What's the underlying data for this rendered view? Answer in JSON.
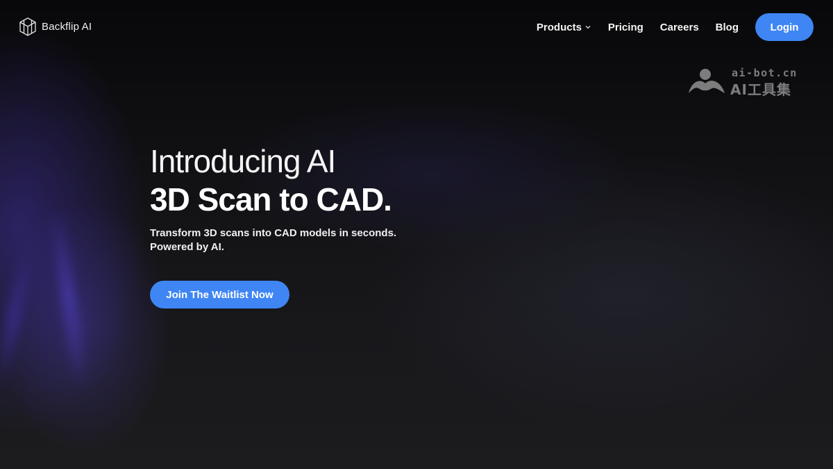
{
  "brand": {
    "name": "Backflip AI",
    "logo_icon": "cube-logo-icon"
  },
  "nav": {
    "items": [
      {
        "label": "Products",
        "icon": "chevron-down-icon"
      },
      {
        "label": "Pricing"
      },
      {
        "label": "Careers"
      },
      {
        "label": "Blog"
      }
    ],
    "login_label": "Login"
  },
  "hero": {
    "title_line1": "Introducing AI",
    "title_line2": "3D Scan to CAD.",
    "subtitle_line1": "Transform 3D scans into CAD models in seconds.",
    "subtitle_line2": "Powered by AI.",
    "cta_label": "Join The Waitlist Now"
  },
  "watermark": {
    "url": "ai-bot.cn",
    "name": "AI工具集"
  },
  "colors": {
    "accent": "#3f86f4",
    "background": "#141417",
    "text": "#ffffff"
  }
}
